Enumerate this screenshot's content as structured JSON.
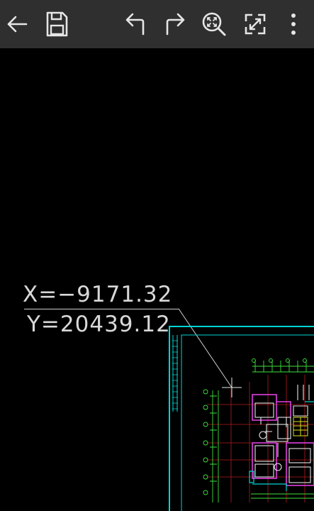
{
  "toolbar": {
    "background": "#2f2f2f",
    "icon_color": "#e6e6e6",
    "buttons": [
      {
        "id": "back",
        "icon": "arrow-left-icon"
      },
      {
        "id": "save",
        "icon": "floppy-disk-icon"
      },
      {
        "id": "undo",
        "icon": "undo-arrow-icon"
      },
      {
        "id": "redo",
        "icon": "redo-arrow-icon"
      },
      {
        "id": "zoom-extents",
        "icon": "zoom-extents-icon"
      },
      {
        "id": "fullscreen",
        "icon": "expand-diagonal-icon"
      },
      {
        "id": "more",
        "icon": "more-vertical-icon"
      }
    ]
  },
  "canvas": {
    "background": "#000000",
    "cursor_readout": {
      "x_text": "X=−9171.32",
      "y_text": "Y=20439.12"
    },
    "colors": {
      "frame": "#00d4d4",
      "grid": "#d02020",
      "walls": "#e0e0e0",
      "rooms": "#e040e0",
      "annotations": "#40e040",
      "highlight": "#e0e020",
      "leader": "#cfcfcf"
    }
  }
}
